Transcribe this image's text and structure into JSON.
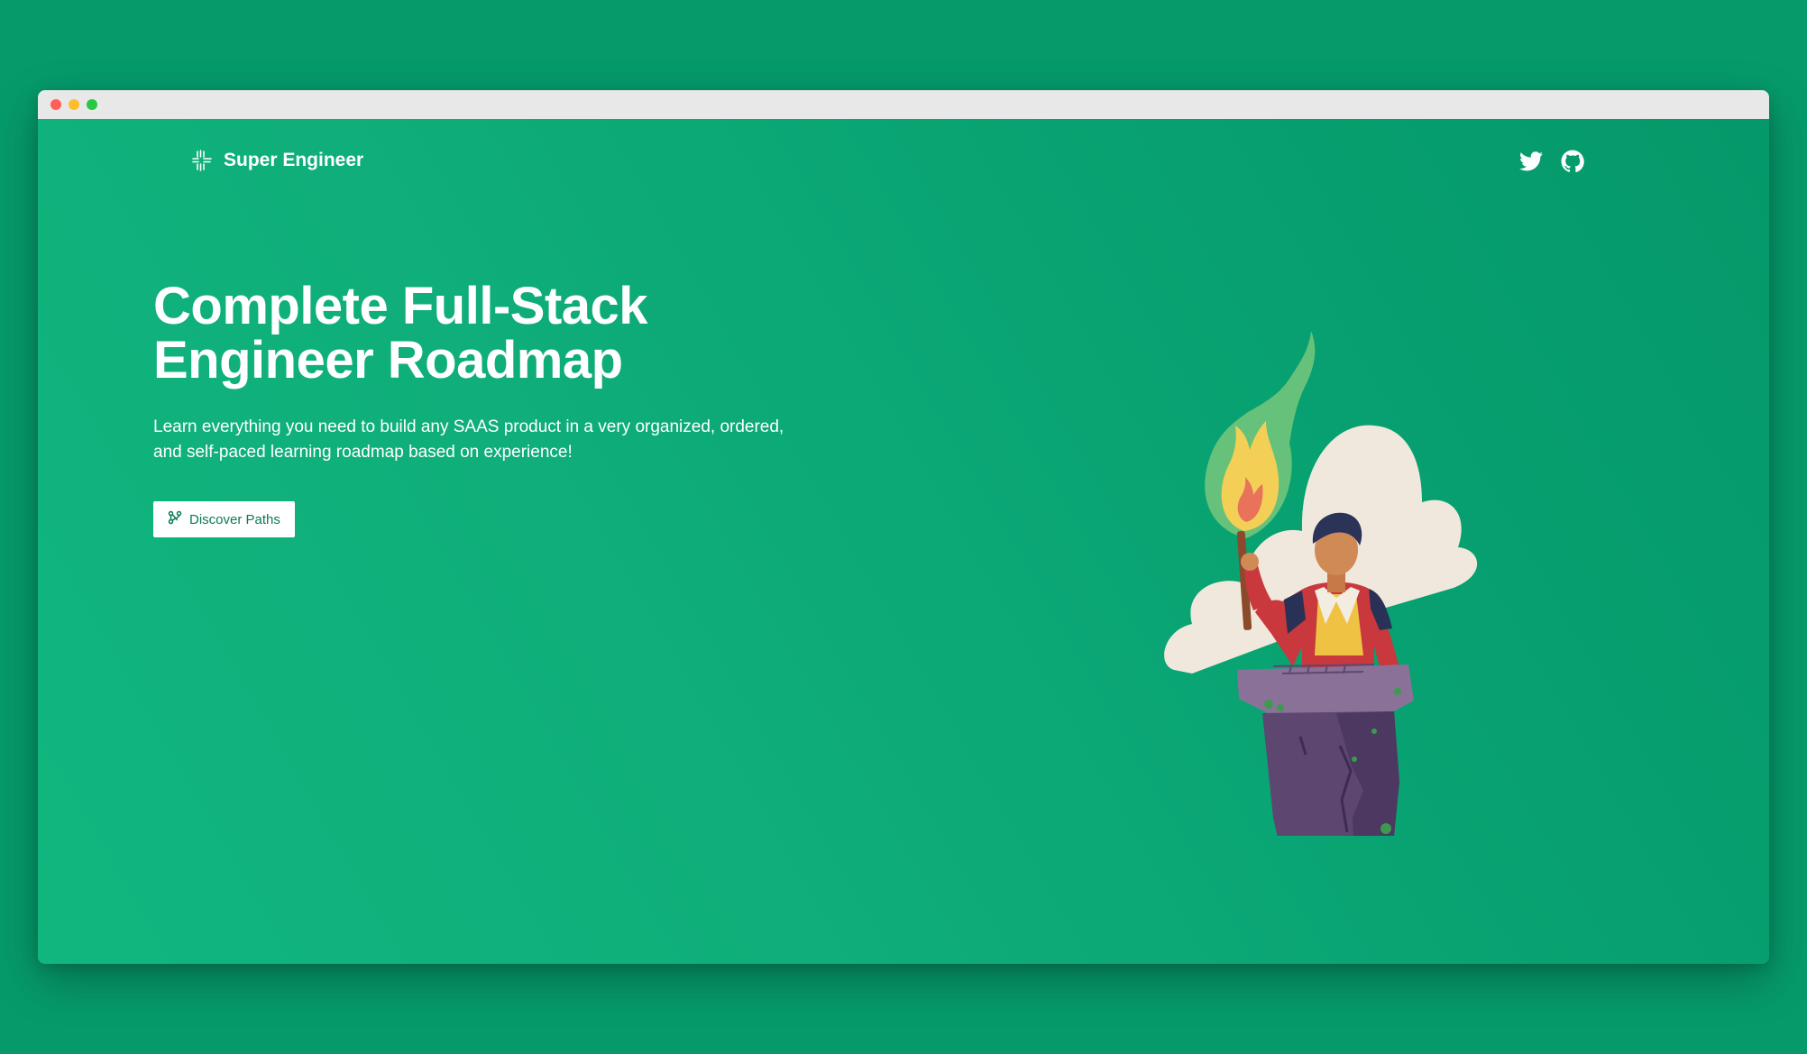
{
  "brand": {
    "name": "Super Engineer",
    "logo_icon": "grid-cross-icon"
  },
  "social": {
    "twitter_icon": "twitter-icon",
    "github_icon": "github-icon"
  },
  "hero": {
    "title_line1": "Complete Full-Stack",
    "title_line2": "Engineer Roadmap",
    "subtitle_line1": "Learn everything you need to build any SAAS product in a very organized, ordered,",
    "subtitle_line2": "and self-paced learning roadmap based on experience!",
    "cta_label": "Discover Paths",
    "cta_icon": "branch-icon"
  },
  "colors": {
    "background": "#069a6b",
    "accent": "#0fae7a",
    "button_text": "#0b7a56"
  }
}
